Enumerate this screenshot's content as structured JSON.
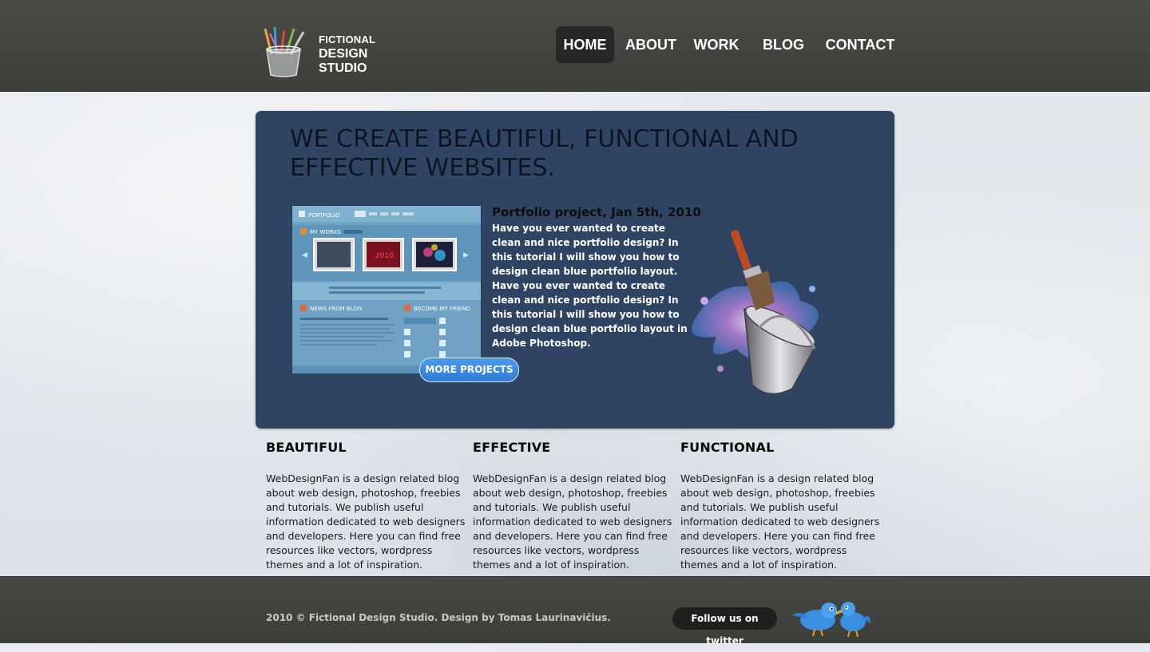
{
  "brand": {
    "line1": "FICTIONAL",
    "line2": "DESIGN",
    "line3": "STUDIO"
  },
  "nav": {
    "items": [
      {
        "label": "HOME",
        "active": true
      },
      {
        "label": "ABOUT",
        "active": false
      },
      {
        "label": "WORK",
        "active": false
      },
      {
        "label": "BLOG",
        "active": false
      },
      {
        "label": "CONTACT",
        "active": false
      }
    ]
  },
  "hero": {
    "title_line1": "WE CREATE BEAUTIFUL, FUNCTIONAL AND",
    "title_line2": "EFFECTIVE WEBSITES.",
    "project_title": "Portfolio project, Jan 5th, 2010",
    "project_text": "Have you ever wanted to create clean and nice portfolio design? In this tutorial I will show you how to design clean blue portfolio layout. Have you ever wanted to create clean and nice portfolio design? In this tutorial I will show you how to design clean blue portfolio layout in Adobe Photoshop.",
    "more_button": "MORE PROJECTS",
    "thumbnail": {
      "logo": "PORTFOLIO",
      "section1": "MY WORKS",
      "thumb_label": "2010",
      "section2": "NEWS FROM BLOG",
      "section3": "BECOME MY FRIEND"
    }
  },
  "columns": [
    {
      "title": "BEAUTIFUL",
      "text": "WebDesignFan is a design related blog about web design, photoshop, freebies and tutorials. We publish useful information dedicated to web designers and developers. Here you can find free resources like vectors, wordpress themes and a lot of inspiration."
    },
    {
      "title": "EFFECTIVE",
      "text": "WebDesignFan is a design related blog about web design, photoshop, freebies and tutorials. We publish useful information dedicated to web designers and developers. Here you can find free resources like vectors, wordpress themes and a lot of inspiration."
    },
    {
      "title": "FUNCTIONAL",
      "text": "WebDesignFan is a design related blog about web design, photoshop, freebies and tutorials. We publish useful information dedicated to web designers and developers. Here you can find free resources like vectors, wordpress themes and a lot of inspiration."
    }
  ],
  "footer": {
    "copyright": "2010 © Fictional Design Studio. Design by Tomas Laurinavičius.",
    "twitter_label": "Follow us on twitter"
  },
  "colors": {
    "header_bg": "#45453f",
    "hero_bg": "#2f4462",
    "button_blue": "#2e7bd6",
    "nav_active": "#262624"
  },
  "icons": [
    "pencil-cup-icon",
    "paint-bucket-brush-icon",
    "twitter-birds-icon"
  ]
}
